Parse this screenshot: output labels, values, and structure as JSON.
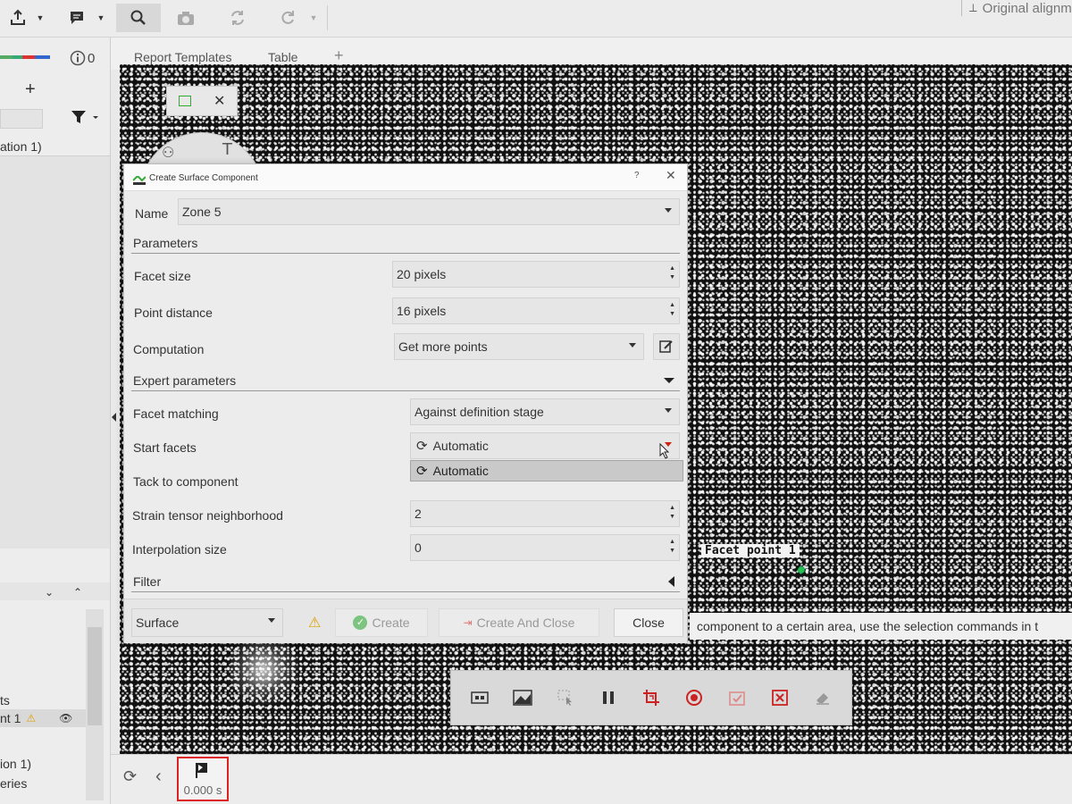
{
  "toolbar": {
    "original_align": "Original alignm"
  },
  "left_panel": {
    "info_count": "0",
    "row_1": "ation 1)",
    "row_2": "ts",
    "row_3": "nt 1",
    "row_4": "ion 1)",
    "row_5": "eries"
  },
  "tabs": [
    "Report Templates",
    "Table"
  ],
  "dialog": {
    "title": "Create Surface Component",
    "help": "?",
    "name_label": "Name",
    "name_value": "Zone 5",
    "parameters": "Parameters",
    "facet_size_label": "Facet size",
    "facet_size_value": "20 pixels",
    "point_distance_label": "Point distance",
    "point_distance_value": "16 pixels",
    "computation_label": "Computation",
    "computation_value": "Get more points",
    "expert": "Expert parameters",
    "facet_matching_label": "Facet matching",
    "facet_matching_value": "Against definition stage",
    "start_facets_label": "Start facets",
    "start_facets_value": "Automatic",
    "start_facets_option": "Automatic",
    "tack_label": "Tack to component",
    "strain_label": "Strain tensor neighborhood",
    "strain_value": "2",
    "interp_label": "Interpolation size",
    "interp_value": "0",
    "filter": "Filter",
    "type_value": "Surface",
    "create": "Create",
    "create_close": "Create And Close",
    "close": "Close"
  },
  "facet_point": "Facet point 1",
  "hint": "component to a certain area, use the selection commands in t",
  "timeline": {
    "time": "0.000 s"
  },
  "colors": {
    "accent_red": "#d22222",
    "facet_green": "#29c24a",
    "create_green": "#4caf50"
  }
}
